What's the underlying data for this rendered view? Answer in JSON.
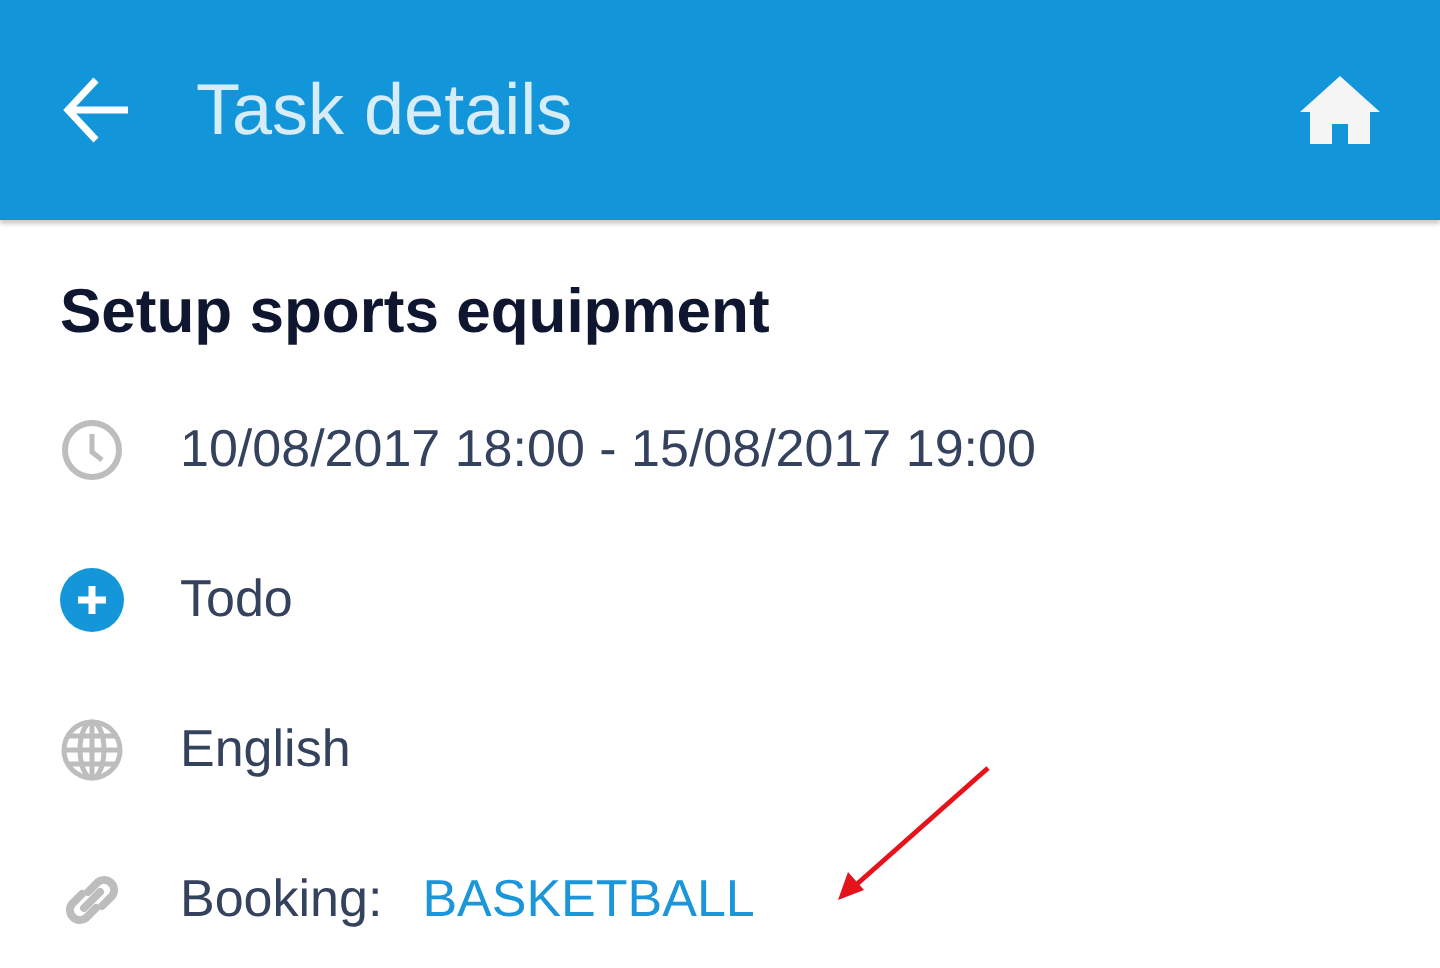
{
  "app_bar": {
    "title": "Task details"
  },
  "task": {
    "title": "Setup sports equipment",
    "rows": [
      {
        "kind": "time",
        "text": "10/08/2017 18:00 - 15/08/2017 19:00"
      },
      {
        "kind": "status",
        "text": "Todo"
      },
      {
        "kind": "language",
        "text": "English"
      },
      {
        "kind": "link",
        "label": "Booking:",
        "link": "BASKETBALL"
      }
    ]
  }
}
